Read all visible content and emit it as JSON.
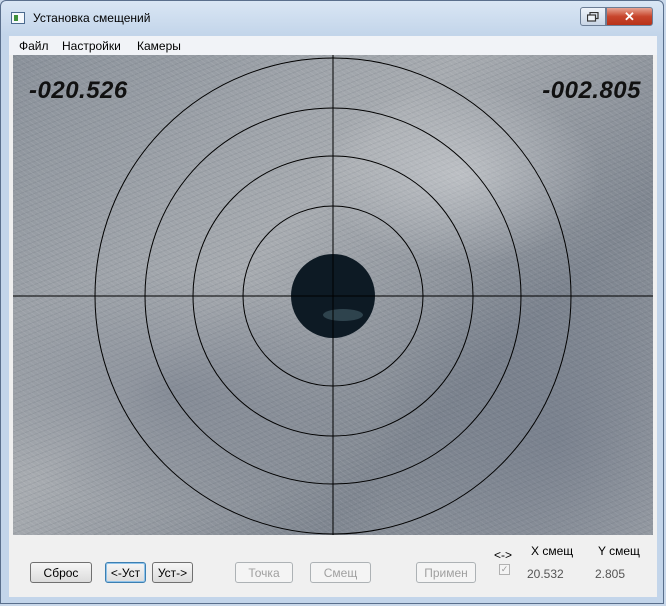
{
  "window": {
    "title": "Установка смещений",
    "restore_icon": "restore-icon",
    "close_icon": "close-icon",
    "close_glyph": "✕"
  },
  "menu": [
    "Файл",
    "Настройки",
    "Камеры"
  ],
  "camera": {
    "x_offset": "-020.526",
    "y_offset": "-002.805",
    "reticle_color": "#000000"
  },
  "buttons": {
    "reset": "Сброс",
    "set_left": "<-Уст",
    "set_right": "Уст->",
    "point": "Точка",
    "shift": "Смещ",
    "apply": "Примен"
  },
  "swap_label": "<->",
  "swap_checked": true,
  "x_shift": {
    "label": "X смещ",
    "value": "20.532"
  },
  "y_shift": {
    "label": "Y смещ",
    "value": "2.805"
  }
}
